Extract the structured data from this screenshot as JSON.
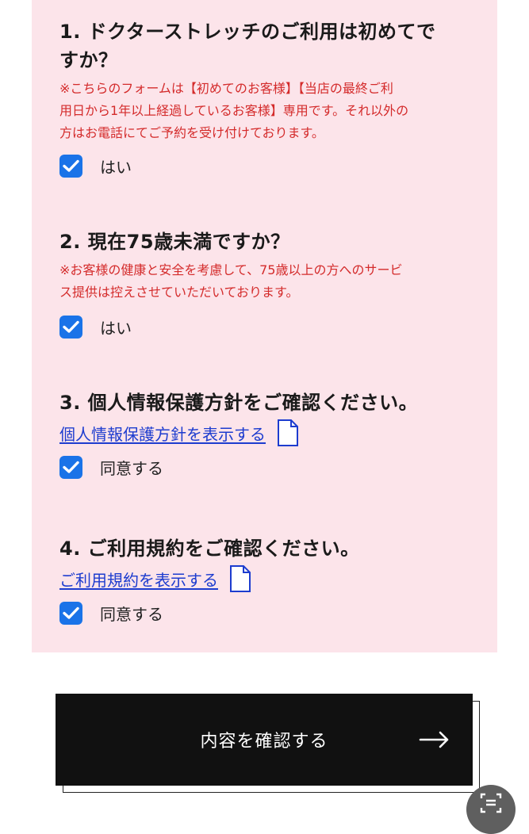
{
  "questions": [
    {
      "title_line1": "1. ドクターストレッチのご利用は初めてで",
      "title_line2": "すか？",
      "note_lines": [
        "※こちらのフォームは【初めてのお客様】【当店の最終ご利",
        "用日から1年以上経過しているお客様】専用です。それ以外の",
        "方はお電話にてご予約を受け付けております。"
      ],
      "checkbox_label": "はい",
      "checked": true
    },
    {
      "title_line1": "2. 現在75歳未満ですか？",
      "note_lines": [
        "※お客様の健康と安全を考慮して、75歳以上の方へのサービ",
        "ス提供は控えさせていただいております。"
      ],
      "checkbox_label": "はい",
      "checked": true
    },
    {
      "title_line1": "3. 個人情報保護方針をご確認ください。",
      "link_label": "個人情報保護方針を表示する",
      "link_icon": "document-icon",
      "checkbox_label": "同意する",
      "checked": true
    },
    {
      "title_line1": "4. ご利用規約をご確認ください。",
      "link_label": "ご利用規約を表示する",
      "link_icon": "document-icon",
      "checkbox_label": "同意する",
      "checked": true
    }
  ],
  "submit": {
    "label": "内容を確認する",
    "icon": "arrow-right-icon"
  },
  "floating_button": {
    "icon": "scan-icon"
  },
  "colors": {
    "panel_bg": "#fce4ea",
    "note_red": "#d42b2b",
    "checkbox_blue": "#1a73e8",
    "link_blue": "#1d3ccf",
    "button_bg": "#111111"
  }
}
